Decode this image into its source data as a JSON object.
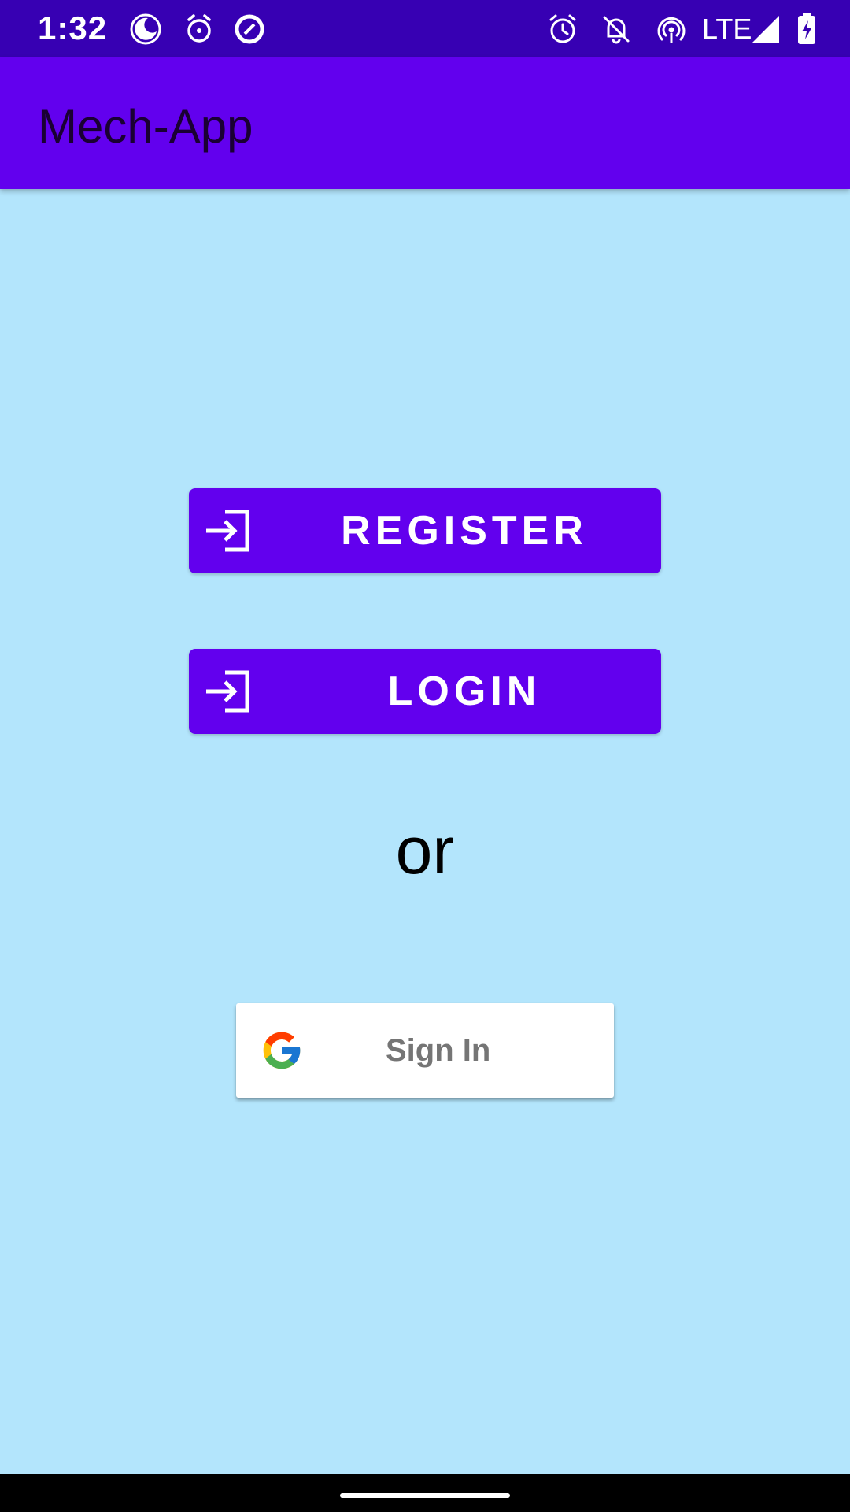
{
  "status_bar": {
    "time": "1:32",
    "left_icons": [
      "moon-icon",
      "alarm-clock-icon",
      "data-saver-icon"
    ],
    "right_icons": [
      "alarm-icon",
      "bell-off-icon",
      "hotspot-icon",
      "signal-icon",
      "battery-charging-icon"
    ],
    "network_label": "LTE"
  },
  "app_bar": {
    "title": "Mech-App"
  },
  "main": {
    "register_label": "REGISTER",
    "login_label": "LOGIN",
    "or_text": "or",
    "google_sign_in_label": "Sign In"
  },
  "colors": {
    "primary": "#6200ee",
    "primary_dark": "#3700b3",
    "background": "#b3e5fc"
  }
}
